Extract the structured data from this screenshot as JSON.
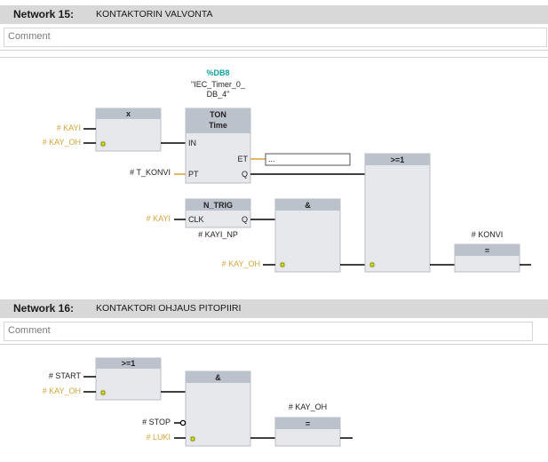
{
  "networks": [
    {
      "number": "Network 15:",
      "title": "KONTAKTORIN VALVONTA",
      "comment_placeholder": "Comment",
      "xor": {
        "title": "x",
        "in1": "# KAYI",
        "in2": "# KAY_OH"
      },
      "timer": {
        "db": "%DB8",
        "instance_line1": "\"IEC_Timer_0_",
        "instance_line2": "DB_4\"",
        "type": "TON",
        "unit": "Time",
        "pin_in": "IN",
        "pin_pt": "PT",
        "pin_et": "ET",
        "pin_q": "Q",
        "pt_operand": "# T_KONVI",
        "et_value": "..."
      },
      "ntrig": {
        "title": "N_TRIG",
        "pin_clk": "CLK",
        "pin_q": "Q",
        "clk_operand": "# KAYI",
        "bit": "# KAYI_NP"
      },
      "and": {
        "title": "&",
        "in2": "# KAY_OH"
      },
      "or": {
        "title": ">=1"
      },
      "assign": {
        "operand": "# KONVI",
        "symbol": "="
      }
    },
    {
      "number": "Network 16:",
      "title": "KONTAKTORI OHJAUS PITOPIIRI",
      "comment_placeholder": "Comment",
      "or": {
        "title": ">=1",
        "in1": "# START",
        "in2": "# KAY_OH"
      },
      "and": {
        "title": "&",
        "in2": "# STOP",
        "in3": "# LUKI"
      },
      "assign": {
        "operand": "# KAY_OH",
        "symbol": "="
      }
    }
  ],
  "colors": {
    "header_bg": "#d8d8d8",
    "box_fill": "#e6e8ec",
    "box_header": "#bcc2cc",
    "operand": "#d6a338",
    "db": "#0fa0a0"
  }
}
